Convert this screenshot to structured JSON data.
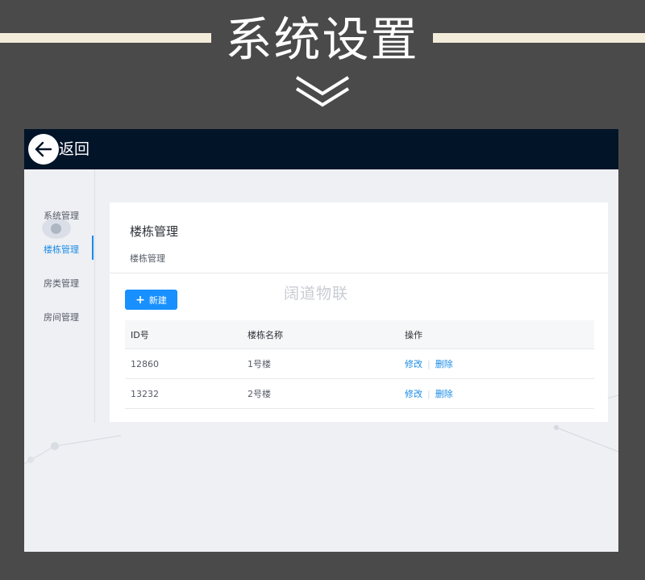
{
  "banner": {
    "title": "系统设置"
  },
  "header": {
    "back_label": "返回"
  },
  "sidebar": {
    "items": [
      {
        "label": "系统管理"
      },
      {
        "label": "楼栋管理"
      },
      {
        "label": "房类管理"
      },
      {
        "label": "房间管理"
      }
    ],
    "active_index": 1
  },
  "main": {
    "title": "楼栋管理",
    "breadcrumb": "楼栋管理",
    "watermark": "阔道物联",
    "new_button": {
      "icon": "plus-icon",
      "label": "新建"
    },
    "table": {
      "columns": [
        "ID号",
        "楼栋名称",
        "操作"
      ],
      "rows": [
        {
          "id": "12860",
          "name": "1号楼",
          "edit": "修改",
          "delete": "删除"
        },
        {
          "id": "13232",
          "name": "2号楼",
          "edit": "修改",
          "delete": "删除"
        }
      ]
    }
  },
  "colors": {
    "page_bg": "#4a4a4a",
    "banner_line": "#f3ecdb",
    "header_bg": "#021428",
    "app_bg": "#eff0f4",
    "accent": "#1890ff",
    "link": "#1a8be8"
  }
}
